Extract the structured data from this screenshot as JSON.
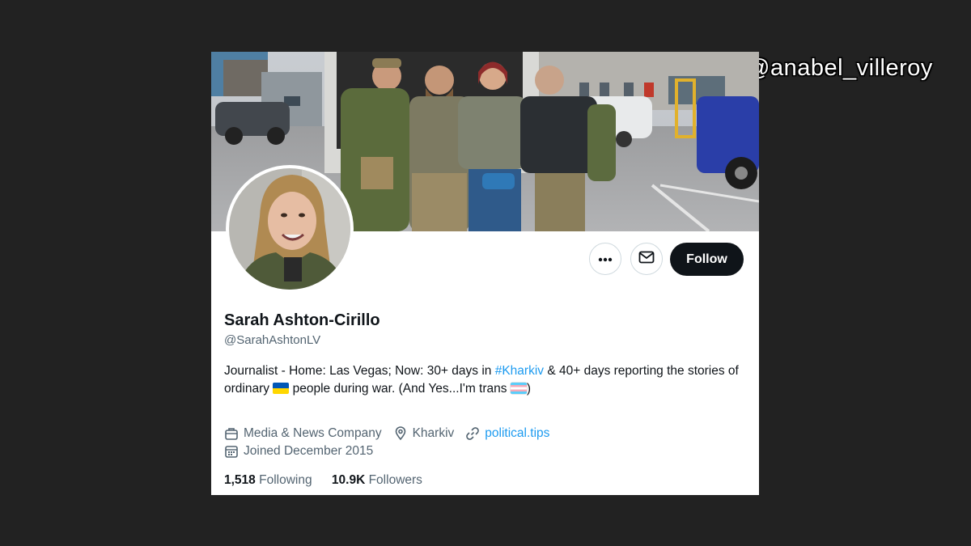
{
  "watermark": "@anabel_villeroy",
  "profile": {
    "name": "Sarah Ashton-Cirillo",
    "handle": "@SarahAshtonLV",
    "bio": {
      "part1": "Journalist - Home: Las Vegas; Now: 30+ days in ",
      "hashtag": "#Kharkiv",
      "part2": " & 40+ days reporting the stories of",
      "part3": "ordinary ",
      "part4": " people during war. (And Yes...I'm trans ",
      "part5": ")"
    },
    "category": "Media & News Company",
    "location": "Kharkiv",
    "website": "political.tips",
    "joined": "Joined December 2015",
    "following_count": "1,518",
    "following_label": "Following",
    "followers_count": "10.9K",
    "followers_label": "Followers"
  },
  "actions": {
    "follow_label": "Follow",
    "more_icon": "more-icon",
    "message_icon": "mail-icon"
  },
  "colors": {
    "link": "#1d9bf0",
    "follow_bg": "#0f1419",
    "muted": "#536471"
  }
}
